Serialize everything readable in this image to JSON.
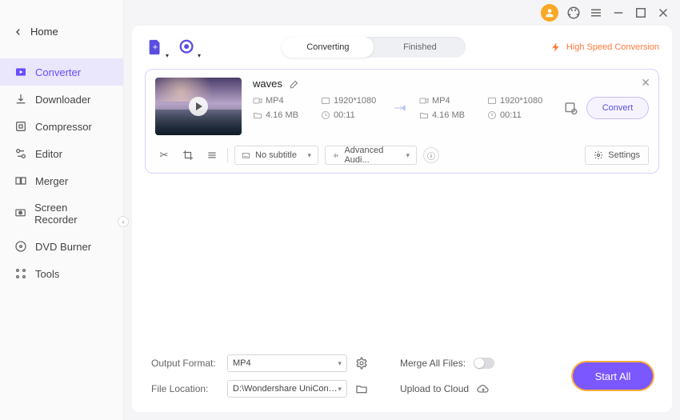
{
  "home": "Home",
  "sidebar": {
    "items": [
      {
        "label": "Converter"
      },
      {
        "label": "Downloader"
      },
      {
        "label": "Compressor"
      },
      {
        "label": "Editor"
      },
      {
        "label": "Merger"
      },
      {
        "label": "Screen Recorder"
      },
      {
        "label": "DVD Burner"
      },
      {
        "label": "Tools"
      }
    ]
  },
  "tabs": {
    "converting": "Converting",
    "finished": "Finished"
  },
  "hispeed": "High Speed Conversion",
  "task": {
    "title": "waves",
    "src": {
      "format": "MP4",
      "resolution": "1920*1080",
      "size": "4.16 MB",
      "duration": "00:11"
    },
    "dst": {
      "format": "MP4",
      "resolution": "1920*1080",
      "size": "4.16 MB",
      "duration": "00:11"
    },
    "convert": "Convert",
    "subtitle_select": "No subtitle",
    "audio_select": "Advanced Audi...",
    "settings": "Settings"
  },
  "bottom": {
    "output_format_label": "Output Format:",
    "output_format_value": "MP4",
    "file_location_label": "File Location:",
    "file_location_value": "D:\\Wondershare UniConverter 1",
    "merge_label": "Merge All Files:",
    "upload_label": "Upload to Cloud",
    "start_all": "Start All"
  }
}
